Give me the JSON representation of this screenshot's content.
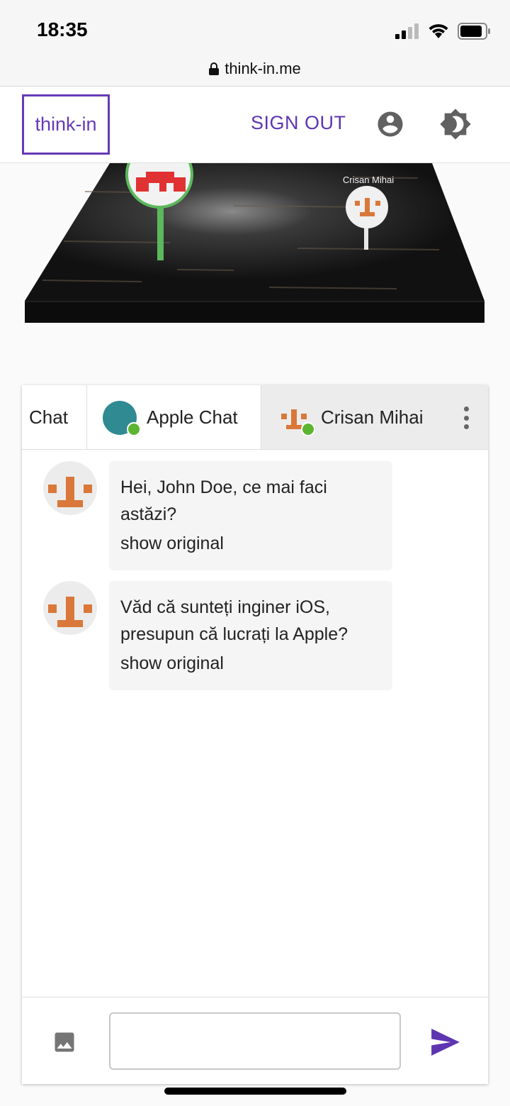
{
  "status_bar": {
    "time": "18:35",
    "icons": [
      "signal-icon",
      "wifi-icon",
      "battery-icon"
    ]
  },
  "url_bar": {
    "domain": "think-in.me",
    "icon": "lock-icon"
  },
  "header": {
    "logo": "think-in",
    "sign_out_label": "SIGN OUT",
    "account_icon": "account-circle-icon",
    "theme_icon": "brightness-icon",
    "accent_color": "#5e35b1"
  },
  "scene": {
    "pin_label": "Crisan Mihai"
  },
  "chat": {
    "tabs": [
      {
        "label": "Chat"
      },
      {
        "label": "Apple Chat",
        "online": true
      },
      {
        "label": "Crisan Mihai",
        "online": true,
        "active": true
      }
    ],
    "messages": [
      {
        "text": "Hei, John Doe, ce mai faci astăzi?",
        "action": "show original"
      },
      {
        "text": "Văd că sunteți inginer iOS, presupun că lucrați la Apple?",
        "action": "show original"
      }
    ],
    "composer": {
      "placeholder": "",
      "image_icon": "image-icon",
      "send_icon": "send-icon"
    }
  }
}
